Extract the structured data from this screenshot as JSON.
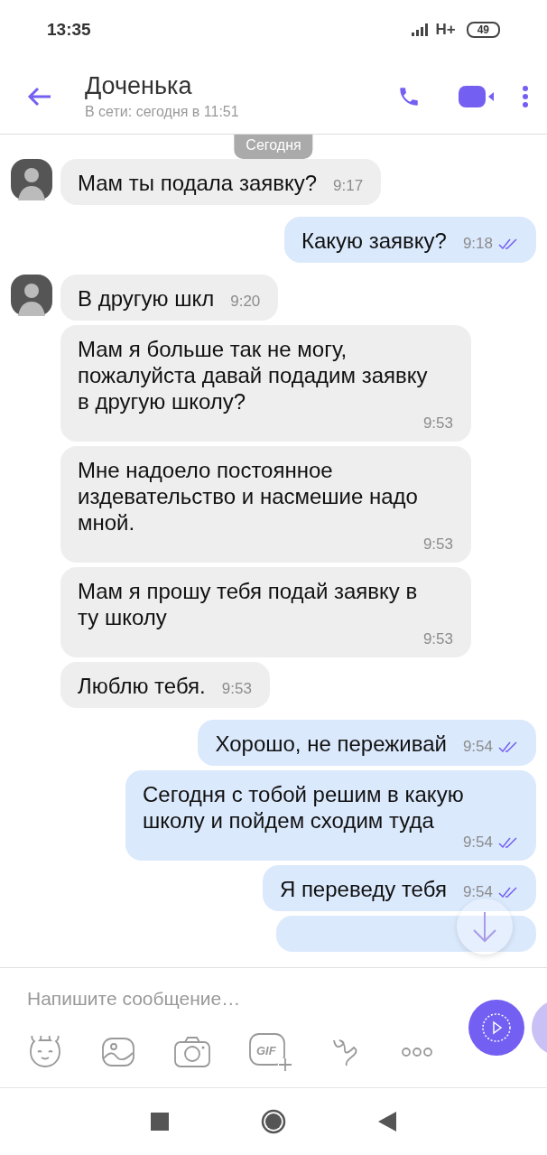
{
  "status_bar": {
    "time": "13:35",
    "network": "H+",
    "battery": "49"
  },
  "header": {
    "title": "Доченька",
    "subtitle": "В сети: сегодня в 11:51"
  },
  "date_chip": "Сегодня",
  "messages": [
    {
      "kind": "incoming",
      "avatar": true,
      "text": "Мам ты подала заявку?",
      "time": "9:17"
    },
    {
      "kind": "outgoing",
      "text": "Какую заявку?",
      "time": "9:18"
    },
    {
      "kind": "incoming",
      "avatar": true,
      "text": "В другую шкл",
      "time": "9:20"
    },
    {
      "kind": "incoming",
      "avatar": false,
      "text": "Мам я больше так не могу, пожалуйста давай подадим заявку в другую школу?",
      "time": "9:53"
    },
    {
      "kind": "incoming",
      "avatar": false,
      "text": "Мне надоело постоянное издевательство и насмешие надо мной.",
      "time": "9:53"
    },
    {
      "kind": "incoming",
      "avatar": false,
      "text": "Мам я прошу тебя подай заявку в ту школу",
      "time": "9:53"
    },
    {
      "kind": "incoming",
      "avatar": false,
      "text": "Люблю тебя.",
      "time": "9:53"
    },
    {
      "kind": "outgoing",
      "text": "Хорошо, не переживай",
      "time": "9:54"
    },
    {
      "kind": "outgoing",
      "text": "Сегодня с тобой решим в какую школу и пойдем сходим туда",
      "time": "9:54"
    },
    {
      "kind": "outgoing",
      "text": "Я переведу тебя",
      "time": "9:54"
    },
    {
      "kind": "outgoing"
    }
  ],
  "composer": {
    "placeholder": "Напишите сообщение…",
    "gif_label": "GIF"
  }
}
